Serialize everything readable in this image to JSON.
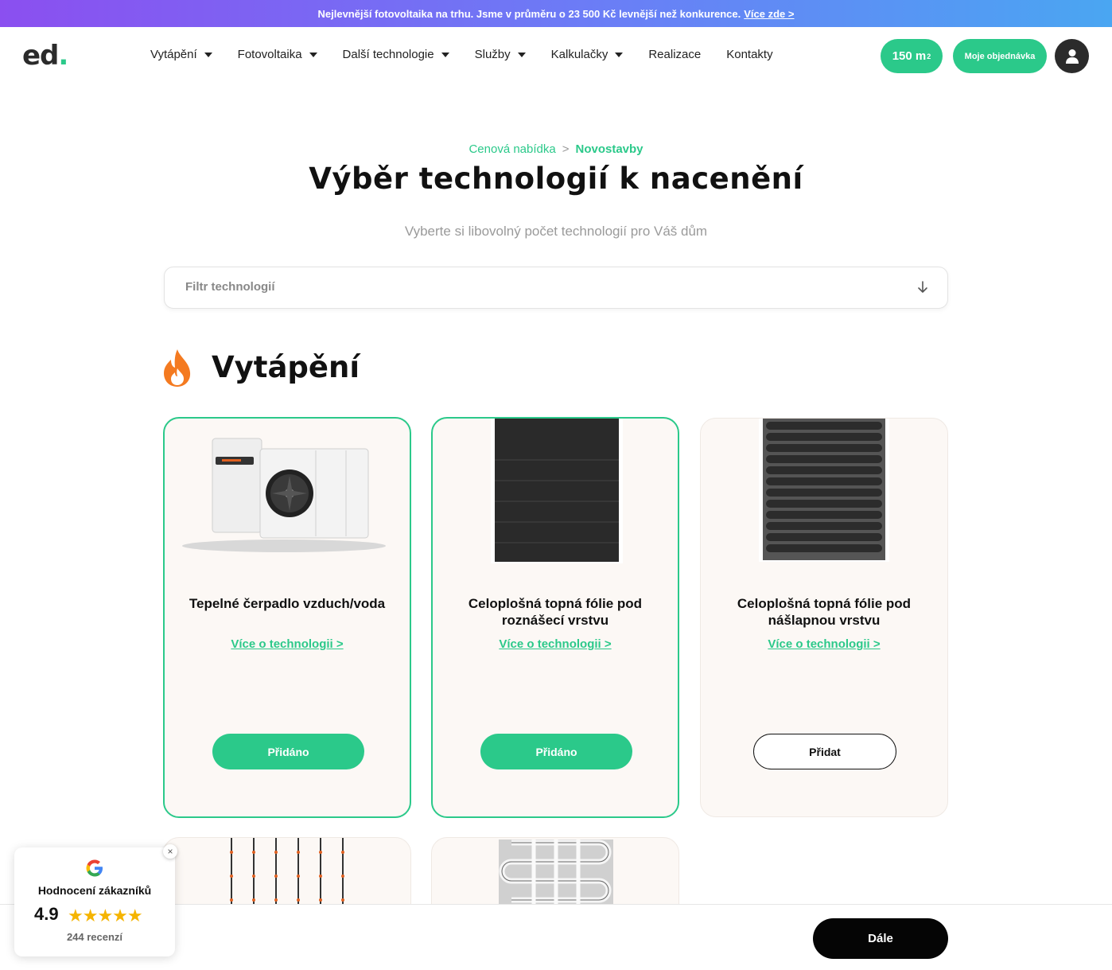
{
  "promo": {
    "text": "Nejlevnější fotovoltaika na trhu. Jsme v průměru o 23 500 Kč levnější než konkurence.",
    "link": "Více zde >"
  },
  "header": {
    "logo_text": "ed",
    "logo_dot": ".",
    "nav": [
      {
        "label": "Vytápění",
        "has_dropdown": true
      },
      {
        "label": "Fotovoltaika",
        "has_dropdown": true
      },
      {
        "label": "Další technologie",
        "has_dropdown": true
      },
      {
        "label": "Služby",
        "has_dropdown": true
      },
      {
        "label": "Kalkulačky",
        "has_dropdown": true
      },
      {
        "label": "Realizace",
        "has_dropdown": false
      },
      {
        "label": "Kontakty",
        "has_dropdown": false
      }
    ],
    "area_value": "150 m",
    "area_sup": "2",
    "order_label": "Moje objednávka",
    "accent_color": "#2bc98a"
  },
  "breadcrumb": {
    "first": "Cenová nabídka",
    "separator": ">",
    "current": "Novostavby"
  },
  "page_title": "Výběr technologií k nacenění",
  "subtitle": "Vyberte si libovolný počet technologií pro Váš dům",
  "filter": {
    "placeholder": "Filtr technologií"
  },
  "section": {
    "title": "Vytápění",
    "icon": "flame-icon"
  },
  "cards": [
    {
      "title": "Tepelné čerpadlo vzduch/voda",
      "link": "Více o technologii >",
      "button": "Přidáno",
      "selected": true,
      "image": "heat-pump-image"
    },
    {
      "title": "Celoplošná topná fólie pod roznášecí vrstvu",
      "link": "Více o technologii >",
      "button": "Přidáno",
      "selected": true,
      "image": "heating-foil-dark-image"
    },
    {
      "title": "Celoplošná topná fólie pod nášlapnou vrstvu",
      "link": "Více o technologii >",
      "button": "Přidat",
      "selected": false,
      "image": "heating-foil-striped-image"
    }
  ],
  "partial_cards": [
    {
      "image": "heating-cables-image"
    },
    {
      "image": "heating-mat-image"
    }
  ],
  "footer": {
    "next_label": "Dále"
  },
  "rating_widget": {
    "title": "Hodnocení zákazníků",
    "score": "4.9",
    "stars": 5,
    "count_text": "244 recenzí",
    "close_label": "×"
  }
}
